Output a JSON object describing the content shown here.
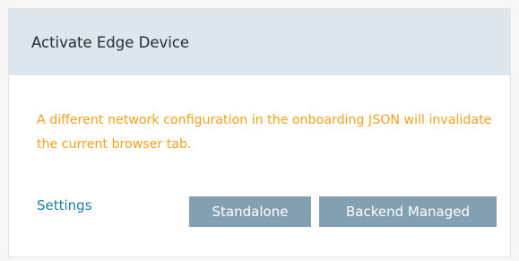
{
  "dialog": {
    "title": "Activate Edge Device",
    "warning": "A different network configuration in the onboarding JSON will invalidate the current browser tab.",
    "settings_link": "Settings",
    "buttons": {
      "standalone": "Standalone",
      "backend_managed": "Backend Managed"
    }
  },
  "colors": {
    "header_bg": "#dde6ec",
    "warning_text": "#f2a21b",
    "link": "#1a7fa8",
    "button_bg": "#83a0b2"
  }
}
